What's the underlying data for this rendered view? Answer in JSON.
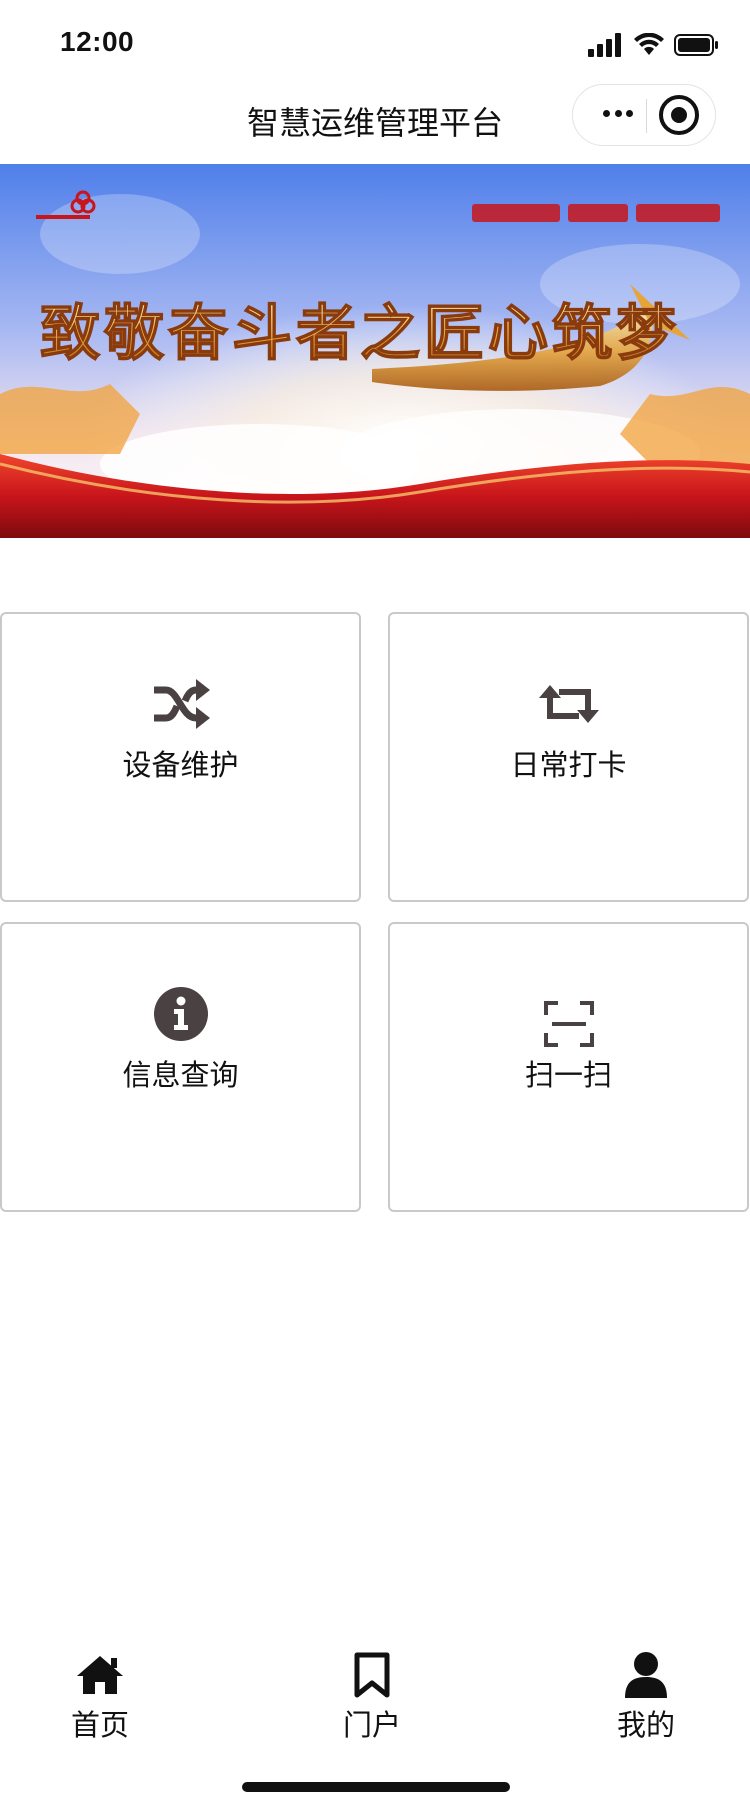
{
  "status_bar": {
    "time": "12:00"
  },
  "nav": {
    "title": "智慧运维管理平台"
  },
  "banner": {
    "slogan": "致敬奋斗者之匠心筑梦",
    "logo_icon": "china-unicom-logo"
  },
  "grid": {
    "items": [
      {
        "label": "设备维护",
        "icon": "shuffle-icon"
      },
      {
        "label": "日常打卡",
        "icon": "retweet-icon"
      },
      {
        "label": "信息查询",
        "icon": "info-circle-icon"
      },
      {
        "label": "扫一扫",
        "icon": "scan-icon"
      }
    ]
  },
  "tabbar": {
    "items": [
      {
        "label": "首页",
        "icon": "home-icon"
      },
      {
        "label": "门户",
        "icon": "bookmark-icon"
      },
      {
        "label": "我的",
        "icon": "user-icon"
      }
    ]
  },
  "colors": {
    "icon": "#4a4143",
    "card_border": "#c9c9c9",
    "text": "#111111",
    "banner_red": "#c8151b",
    "banner_sky": "#5f86e8"
  }
}
